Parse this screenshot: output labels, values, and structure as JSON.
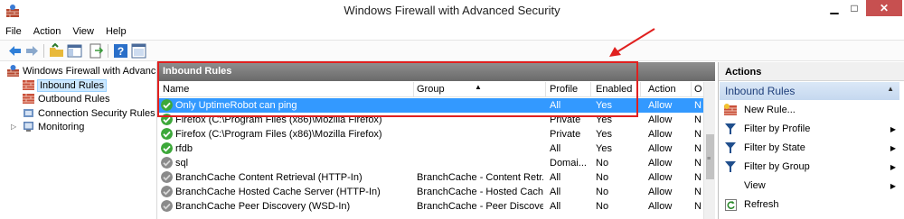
{
  "window": {
    "title": "Windows Firewall with Advanced Security",
    "minimize": "▁",
    "maximize": "□",
    "close": "✕"
  },
  "menu": [
    "File",
    "Action",
    "View",
    "Help"
  ],
  "tree": {
    "root": "Windows Firewall with Advance",
    "items": [
      "Inbound Rules",
      "Outbound Rules",
      "Connection Security Rules",
      "Monitoring"
    ],
    "expander": "▷"
  },
  "center": {
    "title": "Inbound Rules",
    "columns": [
      "Name",
      "Group",
      "Profile",
      "Enabled",
      "Action",
      "O"
    ],
    "rows": [
      {
        "name": "Only UptimeRobot can ping",
        "group": "",
        "profile": "All",
        "enabled": "Yes",
        "action": "Allow",
        "o": "N",
        "icon": "allow-green",
        "selected": true
      },
      {
        "name": "Firefox (C:\\Program Files (x86)\\Mozilla Firefox)",
        "group": "",
        "profile": "Private",
        "enabled": "Yes",
        "action": "Allow",
        "o": "N",
        "icon": "allow-green",
        "selected": false
      },
      {
        "name": "Firefox (C:\\Program Files (x86)\\Mozilla Firefox)",
        "group": "",
        "profile": "Private",
        "enabled": "Yes",
        "action": "Allow",
        "o": "N",
        "icon": "allow-green",
        "selected": false
      },
      {
        "name": "rfdb",
        "group": "",
        "profile": "All",
        "enabled": "Yes",
        "action": "Allow",
        "o": "N",
        "icon": "allow-green",
        "selected": false
      },
      {
        "name": "sql",
        "group": "",
        "profile": "Domai...",
        "enabled": "No",
        "action": "Allow",
        "o": "N",
        "icon": "disabled-gray",
        "selected": false
      },
      {
        "name": "BranchCache Content Retrieval (HTTP-In)",
        "group": "BranchCache - Content Retr...",
        "profile": "All",
        "enabled": "No",
        "action": "Allow",
        "o": "N",
        "icon": "disabled-gray",
        "selected": false
      },
      {
        "name": "BranchCache Hosted Cache Server (HTTP-In)",
        "group": "BranchCache - Hosted Cach...",
        "profile": "All",
        "enabled": "No",
        "action": "Allow",
        "o": "N",
        "icon": "disabled-gray",
        "selected": false
      },
      {
        "name": "BranchCache Peer Discovery (WSD-In)",
        "group": "BranchCache - Peer Discove...",
        "profile": "All",
        "enabled": "No",
        "action": "Allow",
        "o": "N",
        "icon": "disabled-gray",
        "selected": false
      }
    ]
  },
  "actions": {
    "title": "Actions",
    "section": "Inbound Rules",
    "items": [
      {
        "label": "New Rule...",
        "icon": "new-rule-icon",
        "submenu": false
      },
      {
        "label": "Filter by Profile",
        "icon": "filter-icon",
        "submenu": true
      },
      {
        "label": "Filter by State",
        "icon": "filter-icon",
        "submenu": true
      },
      {
        "label": "Filter by Group",
        "icon": "filter-icon",
        "submenu": true
      },
      {
        "label": "View",
        "icon": "",
        "submenu": true
      },
      {
        "label": "Refresh",
        "icon": "refresh-icon",
        "submenu": false
      }
    ]
  },
  "colors": {
    "selection": "#3399ff",
    "annotation": "#e0201f",
    "allow_green": "#3da83a",
    "disabled_gray": "#8a8a8a"
  }
}
